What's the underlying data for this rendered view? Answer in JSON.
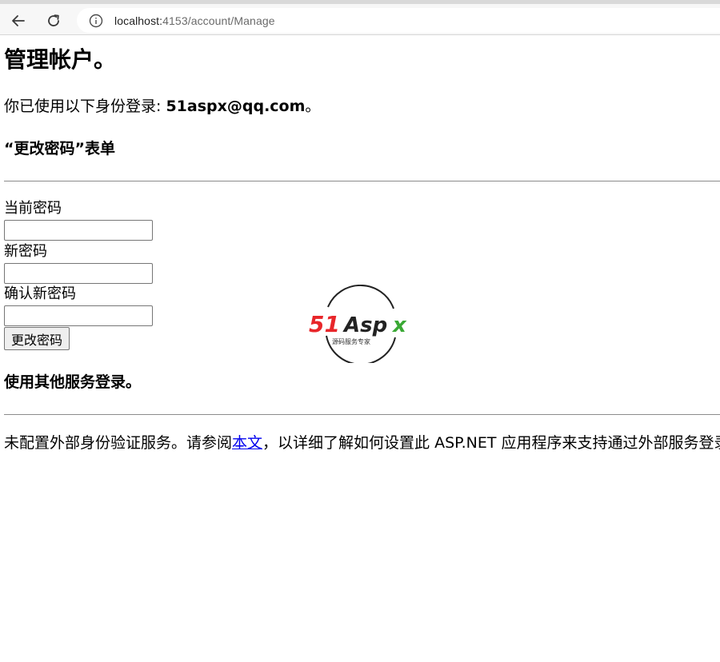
{
  "browser": {
    "url_host": "localhost:",
    "url_rest": "4153/account/Manage"
  },
  "page": {
    "title": "管理帐户。",
    "login_prefix": "你已使用以下身份登录: ",
    "login_email": "51aspx@qq.com",
    "login_suffix": "。",
    "form_title": "“更改密码”表单",
    "current_password_label": "当前密码",
    "new_password_label": "新密码",
    "confirm_password_label": "确认新密码",
    "submit_label": "更改密码",
    "external_title": "使用其他服务登录。",
    "external_text_before": "未配置外部身份验证服务。请参阅",
    "external_link": "本文",
    "external_text_after": "，以详细了解如何设置此 ASP.NET 应用程序来支持通过外部服务登录。"
  },
  "watermark": {
    "brand": "51Aspx",
    "tagline": "源码服务专家"
  },
  "colors": {
    "link": "#0000ee",
    "watermark_red": "#e8262a",
    "watermark_green": "#3aa935"
  }
}
